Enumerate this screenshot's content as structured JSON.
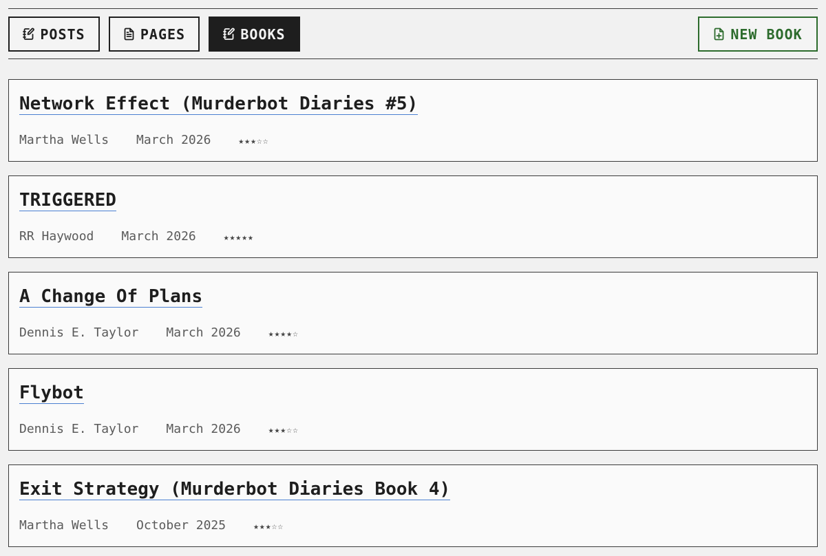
{
  "toolbar": {
    "tabs": [
      {
        "label": "POSTS",
        "icon": "notebook-pen-icon",
        "active": false
      },
      {
        "label": "PAGES",
        "icon": "document-icon",
        "active": false
      },
      {
        "label": "BOOKS",
        "icon": "notebook-pen-icon",
        "active": true
      }
    ],
    "new_book_label": "NEW BOOK",
    "new_book_icon": "file-plus-icon",
    "accent_color": "#2c6b2c"
  },
  "books": [
    {
      "title": "Network Effect (Murderbot Diaries #5)",
      "author": "Martha Wells",
      "date": "March 2026",
      "rating": 3,
      "stars": "★★★☆☆"
    },
    {
      "title": "TRIGGERED",
      "author": "RR Haywood",
      "date": "March 2026",
      "rating": 5,
      "stars": "★★★★★"
    },
    {
      "title": "A Change Of Plans",
      "author": "Dennis E. Taylor",
      "date": "March 2026",
      "rating": 4,
      "stars": "★★★★☆"
    },
    {
      "title": "Flybot",
      "author": "Dennis E. Taylor",
      "date": "March 2026",
      "rating": 3,
      "stars": "★★★☆☆"
    },
    {
      "title": "Exit Strategy (Murderbot Diaries Book 4)",
      "author": "Martha Wells",
      "date": "October 2025",
      "rating": 3,
      "stars": "★★★☆☆"
    }
  ]
}
